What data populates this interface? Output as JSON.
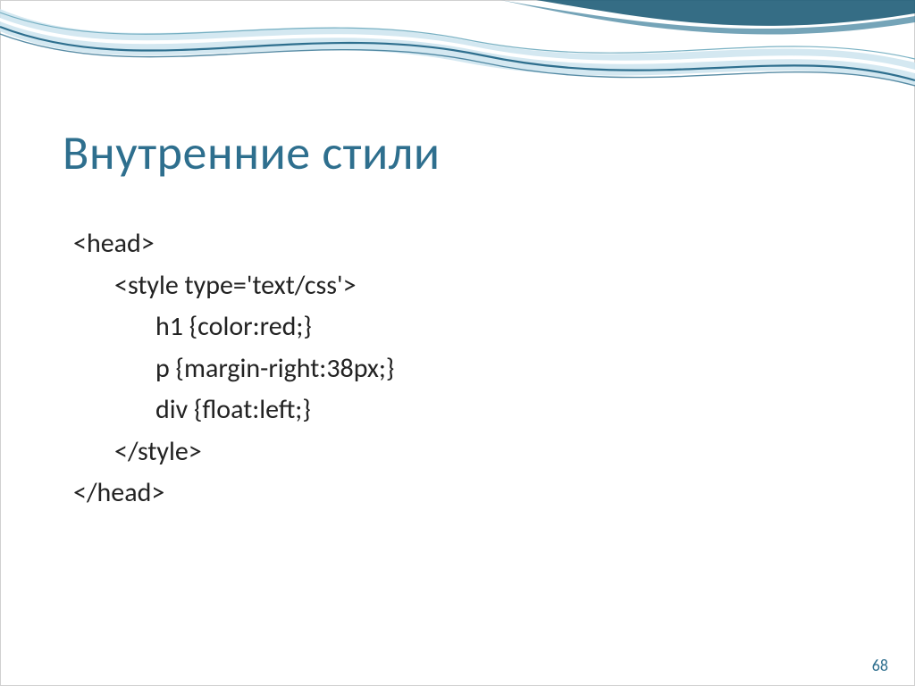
{
  "title": "Внутренние стили",
  "code": {
    "line1": "<head>",
    "line2": "<style type='text/css'>",
    "line3": "h1 {color:red;}",
    "line4": "p {margin-right:38px;}",
    "line5": "div {float:left;}",
    "line6": "</style>",
    "line7": "</head>"
  },
  "page_number": "68"
}
